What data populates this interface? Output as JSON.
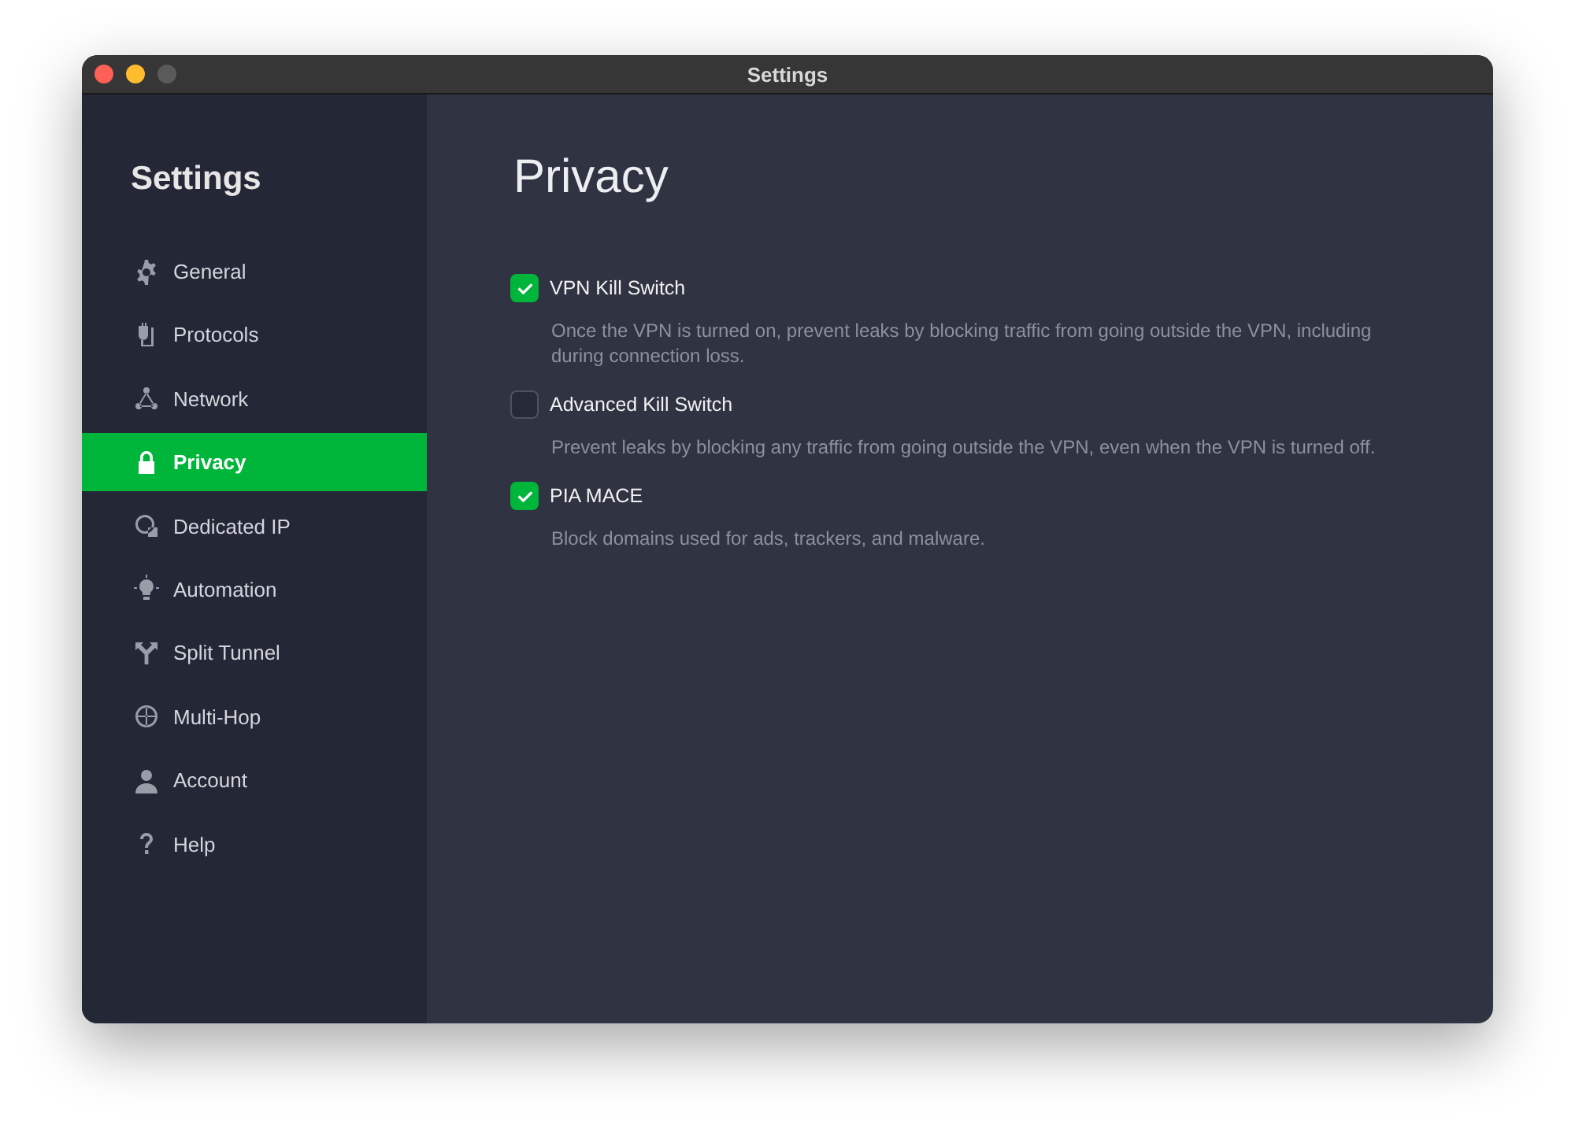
{
  "window": {
    "title": "Settings"
  },
  "sidebar": {
    "title": "Settings",
    "items": [
      {
        "label": "General",
        "selected": false
      },
      {
        "label": "Protocols",
        "selected": false
      },
      {
        "label": "Network",
        "selected": false
      },
      {
        "label": "Privacy",
        "selected": true
      },
      {
        "label": "Dedicated IP",
        "selected": false
      },
      {
        "label": "Automation",
        "selected": false
      },
      {
        "label": "Split Tunnel",
        "selected": false
      },
      {
        "label": "Multi-Hop",
        "selected": false
      },
      {
        "label": "Account",
        "selected": false
      },
      {
        "label": "Help",
        "selected": false
      }
    ]
  },
  "page": {
    "title": "Privacy",
    "options": [
      {
        "label": "VPN Kill Switch",
        "checked": true,
        "description": "Once the VPN is turned on, prevent leaks by blocking traffic from going outside the VPN, including during connection loss."
      },
      {
        "label": "Advanced Kill Switch",
        "checked": false,
        "description": "Prevent leaks by blocking any traffic from going outside the VPN, even when the VPN is turned off."
      },
      {
        "label": "PIA MACE",
        "checked": true,
        "description": "Block domains used for ads, trackers, and malware."
      }
    ]
  }
}
